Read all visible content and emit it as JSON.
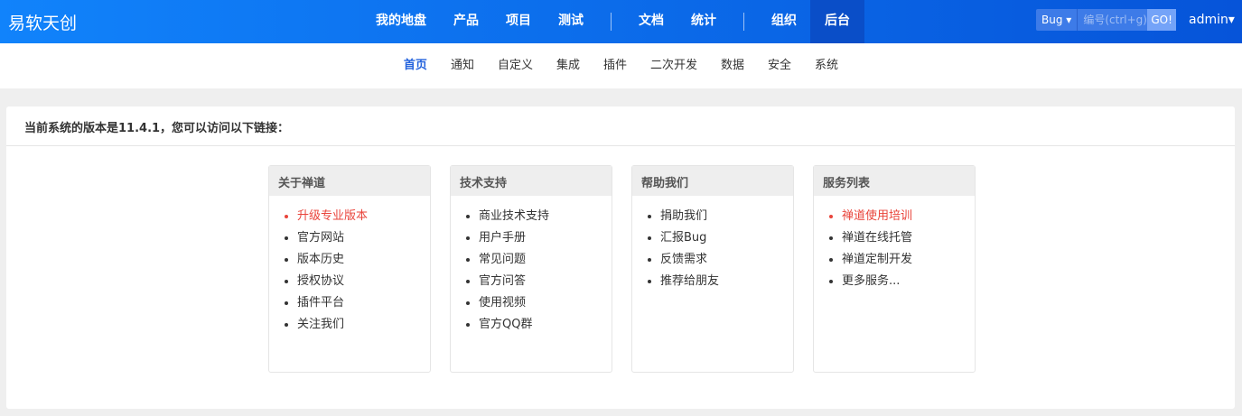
{
  "header": {
    "logo": "易软天创",
    "nav": [
      "我的地盘",
      "产品",
      "项目",
      "测试",
      "文档",
      "统计",
      "组织",
      "后台"
    ],
    "search_type": "Bug",
    "search_placeholder": "编号(ctrl+g)",
    "go": "GO!",
    "user": "admin"
  },
  "subnav": [
    "首页",
    "通知",
    "自定义",
    "集成",
    "插件",
    "二次开发",
    "数据",
    "安全",
    "系统"
  ],
  "panel": {
    "title": "当前系统的版本是11.4.1，您可以访问以下链接：",
    "boxes": [
      {
        "title": "关于禅道",
        "items": [
          "升级专业版本",
          "官方网站",
          "版本历史",
          "授权协议",
          "插件平台",
          "关注我们"
        ]
      },
      {
        "title": "技术支持",
        "items": [
          "商业技术支持",
          "用户手册",
          "常见问题",
          "官方问答",
          "使用视频",
          "官方QQ群"
        ]
      },
      {
        "title": "帮助我们",
        "items": [
          "捐助我们",
          "汇报Bug",
          "反馈需求",
          "推荐给朋友"
        ]
      },
      {
        "title": "服务列表",
        "items": [
          "禅道使用培训",
          "禅道在线托管",
          "禅道定制开发",
          "更多服务..."
        ]
      }
    ]
  },
  "colors": {
    "highlight": "#e9443b",
    "accent": "#2463dd"
  }
}
